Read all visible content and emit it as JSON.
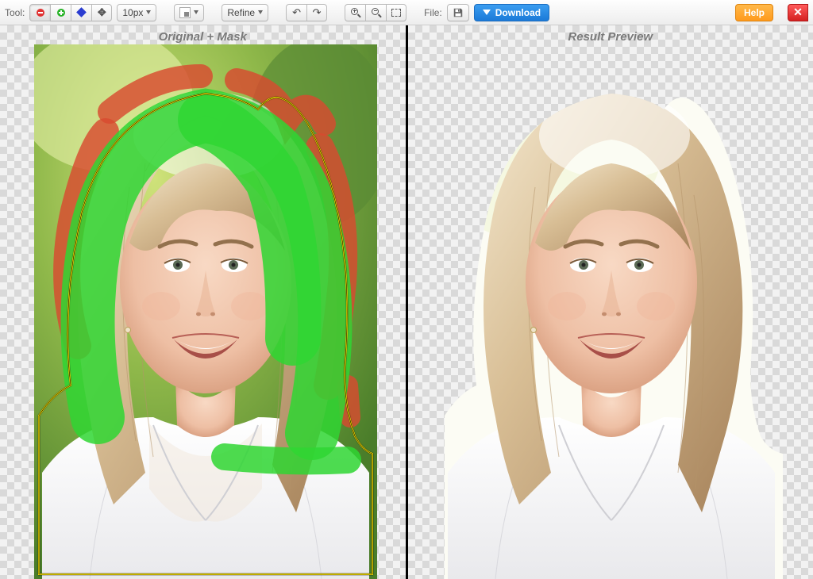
{
  "toolbar": {
    "tool_label": "Tool:",
    "brush_size": "10px",
    "refine": "Refine",
    "file_label": "File:",
    "download": "Download",
    "help": "Help"
  },
  "panels": {
    "left": "Original + Mask",
    "right": "Result Preview"
  },
  "colors": {
    "remove": "#e03030",
    "keep": "#27b327",
    "hair": "#2a3cd0",
    "mask_green": "#2fd633",
    "mask_red": "#d84a2f"
  }
}
